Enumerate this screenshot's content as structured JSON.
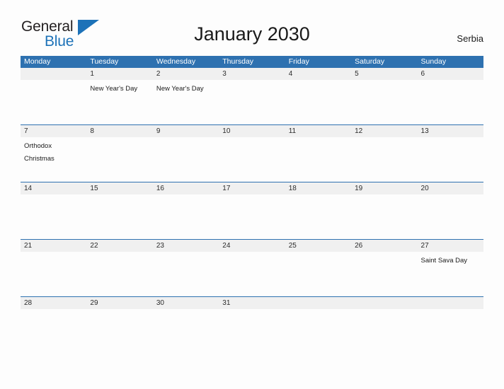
{
  "logo": {
    "word1": "General",
    "word2": "Blue",
    "triangle_color": "#1d72b8"
  },
  "header": {
    "title": "January 2030",
    "country": "Serbia"
  },
  "colors": {
    "header_blue": "#2e71b0",
    "number_row_gray": "#f0f0f0",
    "accent": "#1d72b8"
  },
  "calendar": {
    "weekdays": [
      "Monday",
      "Tuesday",
      "Wednesday",
      "Thursday",
      "Friday",
      "Saturday",
      "Sunday"
    ],
    "weeks": [
      {
        "days": [
          {
            "num": "",
            "event": ""
          },
          {
            "num": "1",
            "event": "New Year's Day"
          },
          {
            "num": "2",
            "event": "New Year's Day"
          },
          {
            "num": "3",
            "event": ""
          },
          {
            "num": "4",
            "event": ""
          },
          {
            "num": "5",
            "event": ""
          },
          {
            "num": "6",
            "event": ""
          }
        ]
      },
      {
        "days": [
          {
            "num": "7",
            "event": "Orthodox\nChristmas"
          },
          {
            "num": "8",
            "event": ""
          },
          {
            "num": "9",
            "event": ""
          },
          {
            "num": "10",
            "event": ""
          },
          {
            "num": "11",
            "event": ""
          },
          {
            "num": "12",
            "event": ""
          },
          {
            "num": "13",
            "event": ""
          }
        ]
      },
      {
        "days": [
          {
            "num": "14",
            "event": ""
          },
          {
            "num": "15",
            "event": ""
          },
          {
            "num": "16",
            "event": ""
          },
          {
            "num": "17",
            "event": ""
          },
          {
            "num": "18",
            "event": ""
          },
          {
            "num": "19",
            "event": ""
          },
          {
            "num": "20",
            "event": ""
          }
        ]
      },
      {
        "days": [
          {
            "num": "21",
            "event": ""
          },
          {
            "num": "22",
            "event": ""
          },
          {
            "num": "23",
            "event": ""
          },
          {
            "num": "24",
            "event": ""
          },
          {
            "num": "25",
            "event": ""
          },
          {
            "num": "26",
            "event": ""
          },
          {
            "num": "27",
            "event": "Saint Sava Day"
          }
        ]
      },
      {
        "days": [
          {
            "num": "28",
            "event": ""
          },
          {
            "num": "29",
            "event": ""
          },
          {
            "num": "30",
            "event": ""
          },
          {
            "num": "31",
            "event": ""
          },
          {
            "num": "",
            "event": ""
          },
          {
            "num": "",
            "event": ""
          },
          {
            "num": "",
            "event": ""
          }
        ]
      }
    ]
  }
}
